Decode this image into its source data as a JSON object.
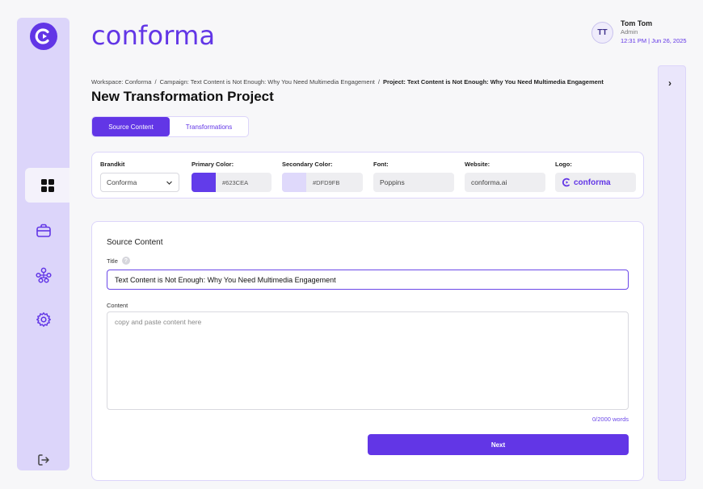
{
  "brand": {
    "name": "conforma",
    "accent": "#6236E6"
  },
  "user": {
    "initials": "TT",
    "name": "Tom Tom",
    "role": "Admin",
    "timestamp": "12:31 PM | Jun 26, 2025"
  },
  "sidebar": {
    "items": [
      {
        "icon": "grid-icon",
        "active": true
      },
      {
        "icon": "briefcase-icon",
        "active": false
      },
      {
        "icon": "hierarchy-icon",
        "active": false
      },
      {
        "icon": "gear-icon",
        "active": false
      }
    ],
    "logout_icon": "logout-icon"
  },
  "breadcrumb": {
    "workspace": "Workspace: Conforma",
    "campaign": "Campaign: Text Content is Not Enough: Why You Need Multimedia Engagement",
    "project": "Project: Text Content is Not Enough: Why You Need Multimedia Engagement",
    "separator": "/"
  },
  "page": {
    "title": "New Transformation Project"
  },
  "tabs": [
    {
      "label": "Source Content",
      "active": true
    },
    {
      "label": "Transformations",
      "active": false
    }
  ],
  "brandkit": {
    "brandkit_label": "Brandkit",
    "brandkit_value": "Conforma",
    "primary_label": "Primary Color:",
    "primary_value": "#623CEA",
    "secondary_label": "Secondary Color:",
    "secondary_value": "#DFD9FB",
    "font_label": "Font:",
    "font_value": "Poppins",
    "website_label": "Website:",
    "website_value": "conforma.ai",
    "logo_label": "Logo:",
    "logo_value": "conforma"
  },
  "source": {
    "heading": "Source Content",
    "title_label": "Title",
    "title_value": "Text Content is Not Enough: Why You Need Multimedia Engagement",
    "content_label": "Content",
    "content_placeholder": "copy and paste content here",
    "word_count": "0/2000 words",
    "next_label": "Next"
  }
}
